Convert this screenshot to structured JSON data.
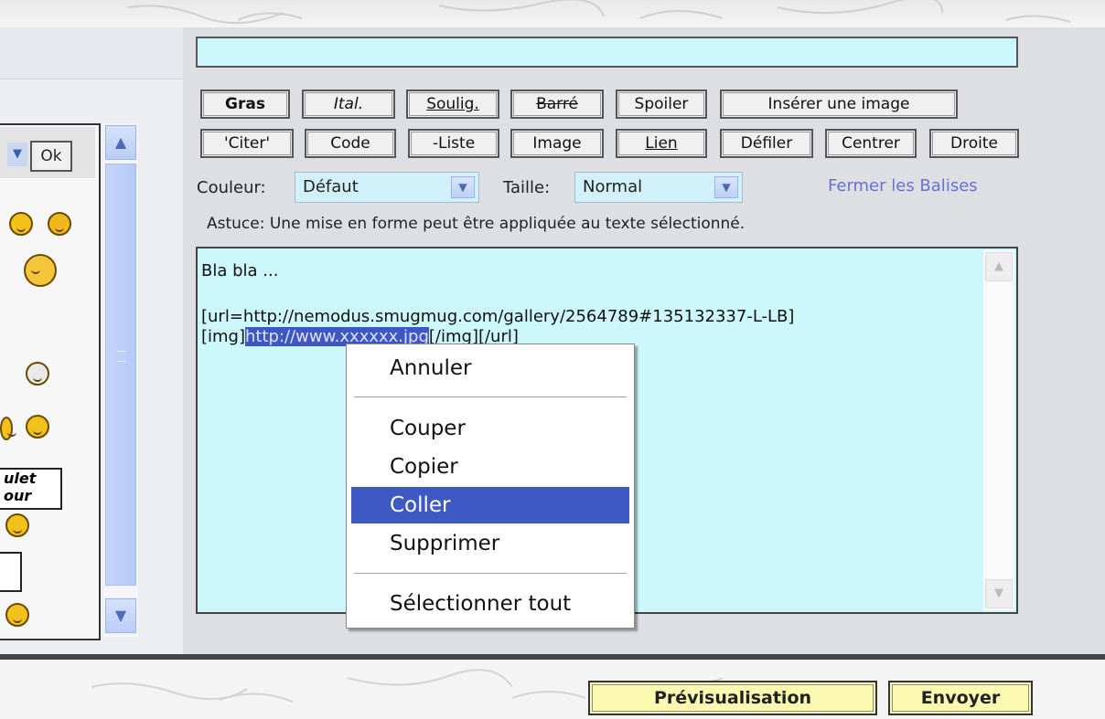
{
  "colors": {
    "field_bg": "#ccf7fb",
    "selection": "#3f57c3",
    "menu_highlight": "#3f59c4",
    "action_button": "#fbfab0",
    "link": "#6a6fd6"
  },
  "left_panel": {
    "ok_label": "Ok",
    "stamp_text": [
      "ulet",
      "our"
    ]
  },
  "toolbar": {
    "row1": [
      "Gras",
      "Ital.",
      "Soulig.",
      "Barré",
      "Spoiler",
      "Insérer une image"
    ],
    "row2": [
      "'Citer'",
      "Code",
      "-Liste",
      "Image",
      "Lien",
      "Défiler",
      "Centrer",
      "Droite"
    ]
  },
  "format": {
    "color_label": "Couleur:",
    "color_value": "Défaut",
    "size_label": "Taille:",
    "size_value": "Normal",
    "close_tags": "Fermer les Balises"
  },
  "hint": "Astuce: Une mise en forme peut être appliquée au texte sélectionné.",
  "editor": {
    "line1": "Bla bla ...",
    "line3": "[url=http://nemodus.smugmug.com/gallery/2564789#135132337-L-LB]",
    "line4_prefix": "[img]",
    "line4_selected": "http://www.xxxxxx.jpg",
    "line4_suffix": "[/img][/url]"
  },
  "context_menu": {
    "items": [
      "Annuler",
      "Couper",
      "Copier",
      "Coller",
      "Supprimer",
      "Sélectionner tout"
    ],
    "highlighted": "Coller"
  },
  "actions": {
    "preview": "Prévisualisation",
    "send": "Envoyer"
  }
}
